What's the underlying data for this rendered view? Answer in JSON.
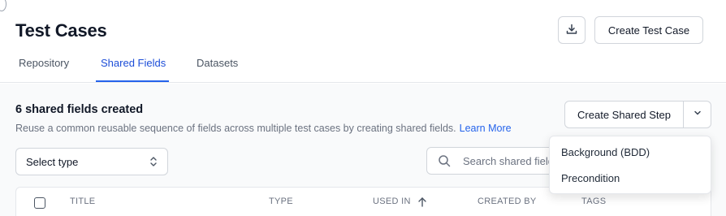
{
  "header": {
    "title": "Test Cases",
    "create_button_label": "Create Test Case"
  },
  "tabs": [
    {
      "label": "Repository",
      "active": false
    },
    {
      "label": "Shared Fields",
      "active": true
    },
    {
      "label": "Datasets",
      "active": false
    }
  ],
  "section": {
    "title": "6 shared fields created",
    "description": "Reuse a common reusable sequence of fields across multiple test cases by creating shared fields.",
    "learn_more": "Learn More"
  },
  "split_button": {
    "label": "Create Shared Step"
  },
  "filters": {
    "select_type_value": "Select type",
    "search_placeholder": "Search shared fields"
  },
  "table": {
    "columns": [
      "TITLE",
      "TYPE",
      "USED IN",
      "CREATED BY",
      "TAGS"
    ]
  },
  "dropdown": {
    "items": [
      "Background (BDD)",
      "Precondition"
    ]
  },
  "colors": {
    "accent": "#2563eb",
    "border": "#d1d5db",
    "background": "#f9fafb"
  },
  "icons": [
    "download-icon",
    "chevron-down-icon",
    "sort-arrows-icon",
    "search-icon",
    "arrow-up-icon"
  ]
}
